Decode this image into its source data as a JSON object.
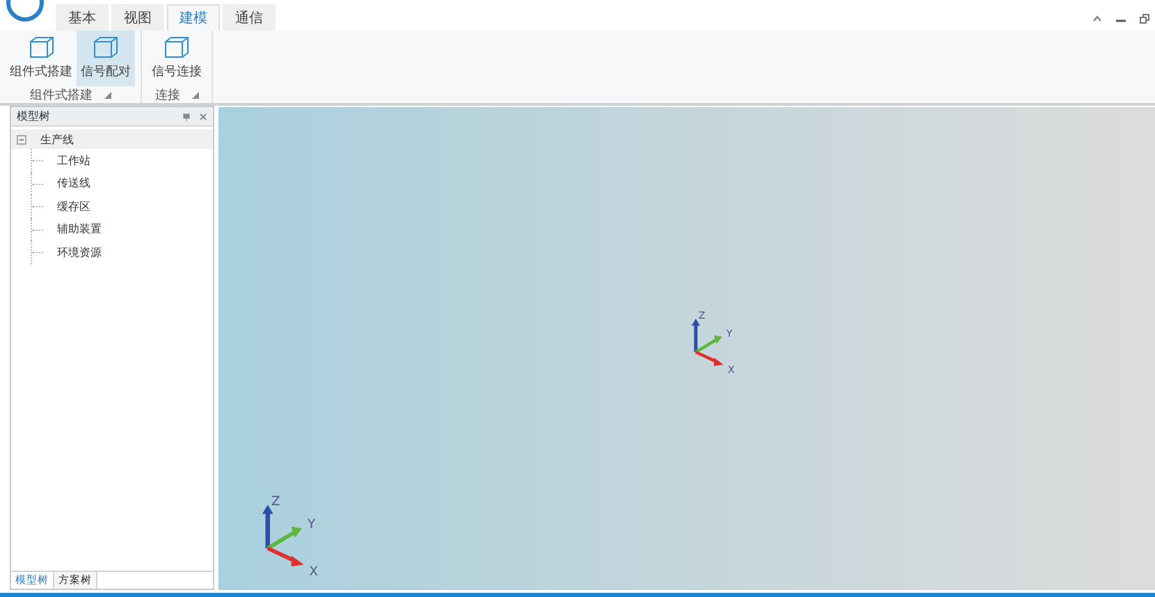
{
  "ribbon_tabs": [
    {
      "label": "基本",
      "selected": false
    },
    {
      "label": "视图",
      "selected": false
    },
    {
      "label": "建模",
      "selected": true
    },
    {
      "label": "通信",
      "selected": false
    }
  ],
  "ribbon_groups": [
    {
      "label": "组件式搭建",
      "buttons": [
        {
          "label": "组件式搭建",
          "selected": false
        },
        {
          "label": "信号配对",
          "selected": true
        }
      ]
    },
    {
      "label": "连接",
      "buttons": [
        {
          "label": "信号连接",
          "selected": false
        }
      ]
    }
  ],
  "model_tree": {
    "title": "模型树",
    "items": [
      {
        "label": "生产线",
        "expanded": true,
        "selected": true,
        "children": [
          {
            "label": "工作站",
            "selected": false
          },
          {
            "label": "传送线",
            "selected": false
          },
          {
            "label": "缓存区",
            "selected": false
          },
          {
            "label": "辅助装置",
            "selected": false
          },
          {
            "label": "环境资源",
            "selected": false
          }
        ]
      }
    ]
  },
  "bottom_tabs": [
    {
      "label": "模型树",
      "selected": true
    },
    {
      "label": "方案树",
      "selected": false
    }
  ],
  "gizmos": [
    {
      "labels": [
        "Z",
        "Y",
        "X"
      ]
    },
    {
      "labels": [
        "Z",
        "Y",
        "X"
      ]
    }
  ]
}
